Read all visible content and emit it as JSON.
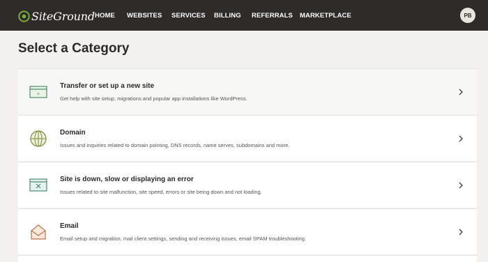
{
  "brand": {
    "name": "SiteGround",
    "accent": "#7fb342"
  },
  "nav": {
    "items": [
      {
        "label": "HOME"
      },
      {
        "label": "WEBSITES"
      },
      {
        "label": "SERVICES"
      },
      {
        "label": "BILLING"
      },
      {
        "label": "REFERRALS"
      },
      {
        "label": "MARKETPLACE"
      }
    ],
    "avatar_initials": "PB"
  },
  "page": {
    "title": "Select a Category"
  },
  "categories": [
    {
      "icon": "browser-window-icon",
      "title": "Transfer or set up a new site",
      "description": "Get help with site setup, migrations and popular app installations like WordPress."
    },
    {
      "icon": "globe-icon",
      "title": "Domain",
      "description": "Issues and inquiries related to domain pointing, DNS records, name serves, subdomains and more."
    },
    {
      "icon": "browser-error-icon",
      "title": "Site is down, slow or displaying an error",
      "description": "Issues related to site malfunction, site speed, errors or site being down and not loading."
    },
    {
      "icon": "envelope-icon",
      "title": "Email",
      "description": "Email setup and migration, mail client settings, sending and receiving issues, email SPAM troubleshooting."
    }
  ]
}
